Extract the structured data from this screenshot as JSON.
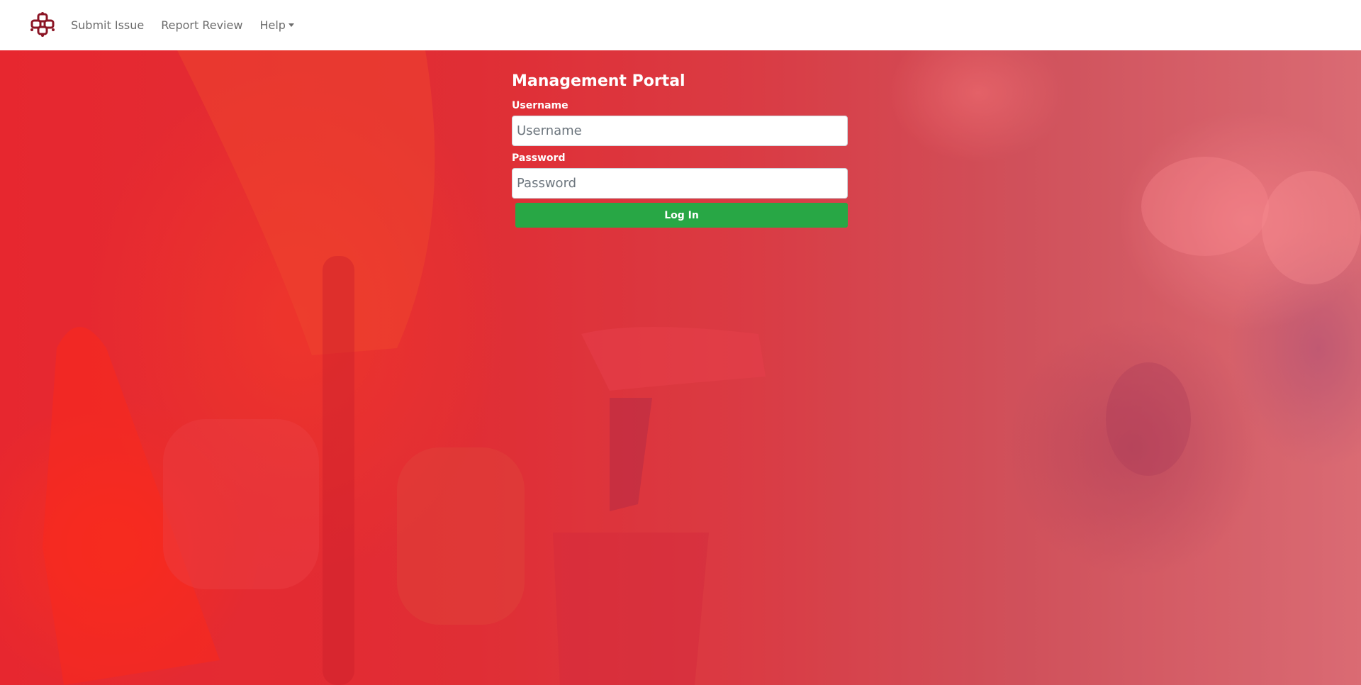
{
  "navbar": {
    "logo_icon": "organization-logo-icon",
    "links": [
      {
        "label": "Submit Issue"
      },
      {
        "label": "Report Review"
      },
      {
        "label": "Help"
      }
    ]
  },
  "login": {
    "title": "Management Portal",
    "username_label": "Username",
    "username_placeholder": "Username",
    "username_value": "",
    "password_label": "Password",
    "password_placeholder": "Password",
    "password_value": "",
    "submit_label": "Log In"
  },
  "colors": {
    "brand": "#8b1424",
    "hero_tint": "#e8282f",
    "button": "#28a745"
  }
}
